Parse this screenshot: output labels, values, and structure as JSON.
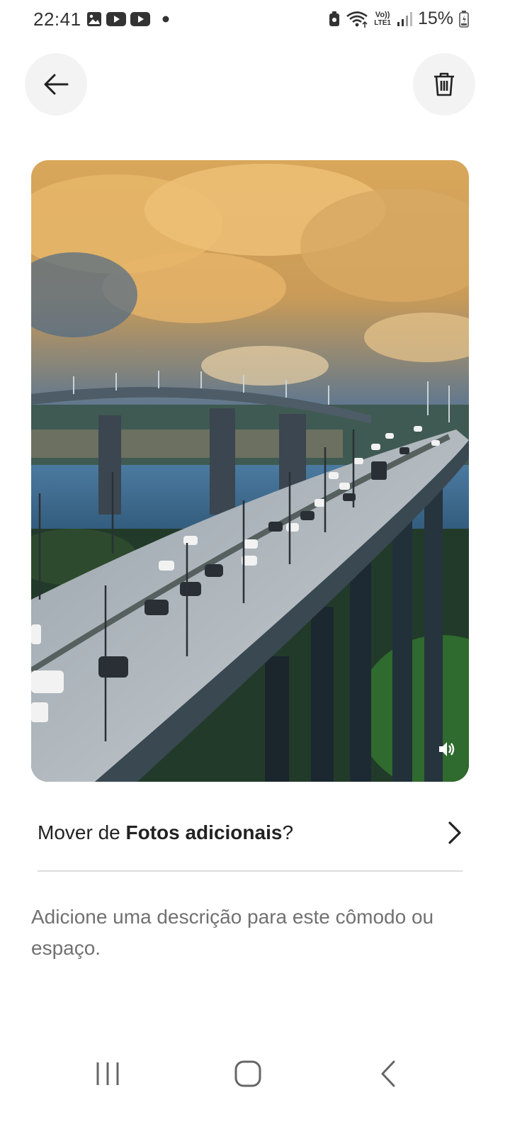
{
  "status_bar": {
    "time": "22:41",
    "network_label": "LTE1",
    "volte_label": "Vo))",
    "battery_text": "15%",
    "left_icons": [
      "gallery-icon",
      "youtube-icon",
      "youtube-icon",
      "dot-icon"
    ],
    "right_icons": [
      "lock-icon",
      "wifi-icon",
      "volte-icon",
      "signal-icon",
      "battery-icon"
    ]
  },
  "header": {
    "back_icon": "arrow-left-icon",
    "delete_icon": "trash-icon"
  },
  "photo": {
    "subject": "Highway bridge over water under yellow clouds",
    "volume_icon": "speaker-icon"
  },
  "move": {
    "prefix": "Mover de ",
    "album": "Fotos adicionais",
    "suffix": "?",
    "chevron_icon": "chevron-right-icon"
  },
  "description_placeholder": "Adicione uma descrição para este cômodo ou espaço.",
  "nav": {
    "recents_icon": "recents-icon",
    "home_icon": "home-icon",
    "back_icon": "back-icon"
  },
  "colors": {
    "button_bg": "#f3f3f3",
    "divider": "#dddddd",
    "placeholder_text": "#717171"
  }
}
